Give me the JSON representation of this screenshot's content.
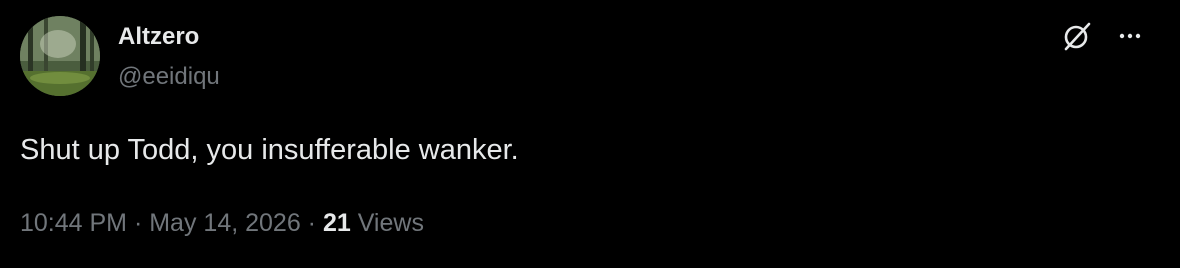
{
  "author": {
    "display_name": "Altzero",
    "handle": "@eeidiqu",
    "avatar_icon": "forest-avatar"
  },
  "actions": {
    "grok_icon": "grok-icon",
    "more_icon": "more-options-icon"
  },
  "tweet": {
    "text": "Shut up Todd, you insufferable wanker."
  },
  "meta": {
    "time": "10:44 PM",
    "separator": " · ",
    "date": "May 14, 2026",
    "views_count": "21",
    "views_label": " Views"
  },
  "colors": {
    "background": "#000000",
    "primary_text": "#e7e9ea",
    "secondary_text": "#71767b"
  }
}
